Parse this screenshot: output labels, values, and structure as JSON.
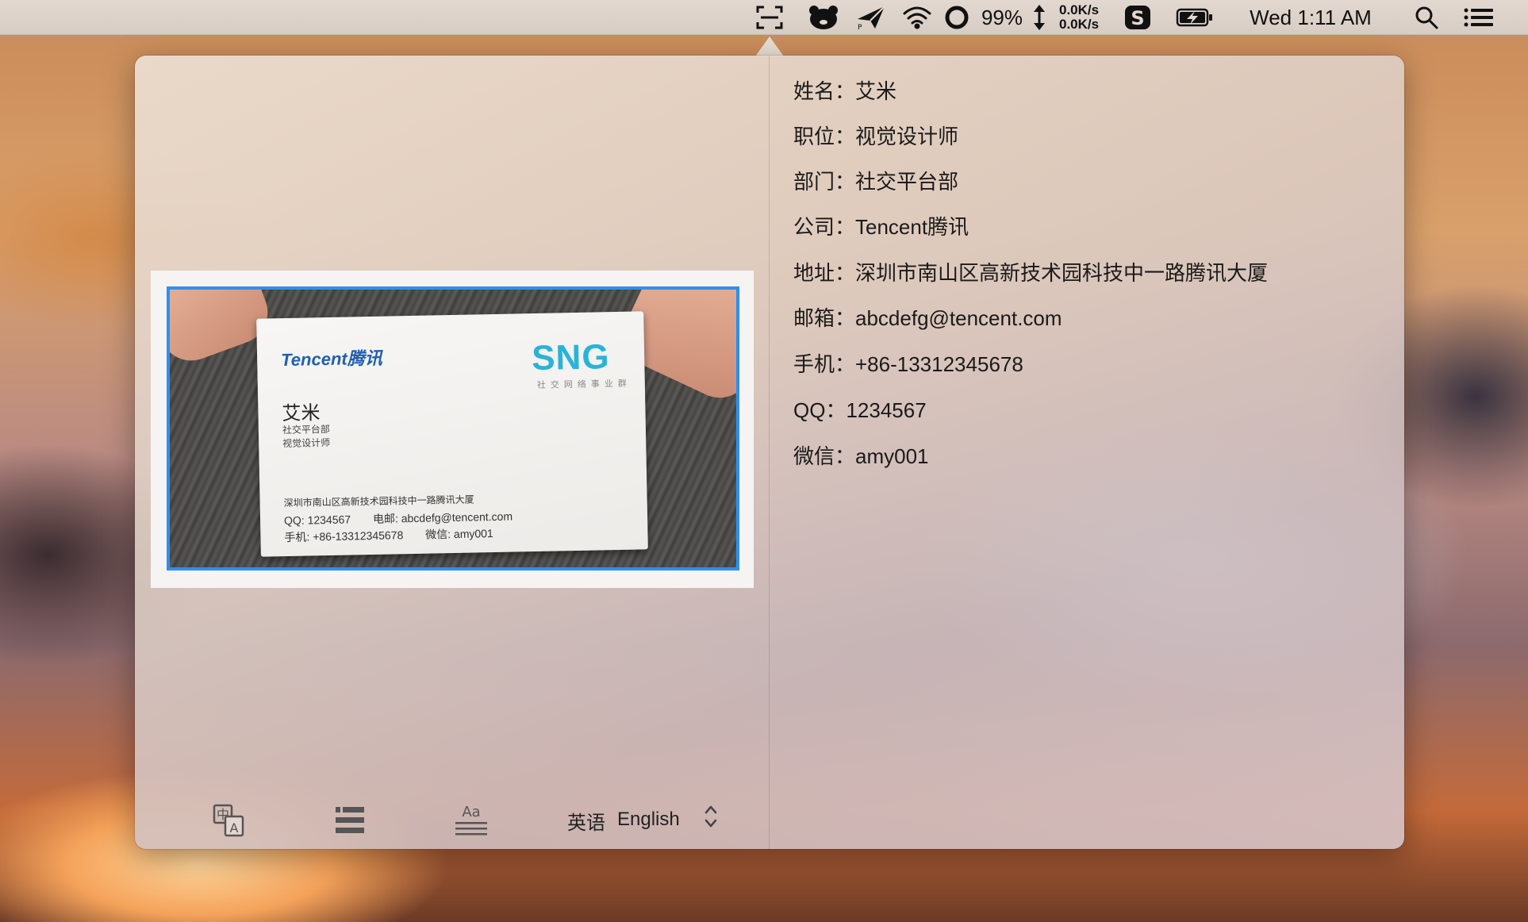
{
  "menubar": {
    "icons": [
      "screenshot-ocr-icon",
      "bear-icon",
      "paper-plane-icon",
      "wifi-icon",
      "istat-ring-icon",
      "updown-arrow-icon",
      "sogou-s-icon",
      "battery-charging-icon",
      "spotlight-search-icon",
      "notification-list-icon"
    ],
    "battery_percent": "99%",
    "net_up": "0.0K/s",
    "net_down": "0.0K/s",
    "clock": "Wed 1:11 AM"
  },
  "card_image": {
    "brand": "Tencent腾讯",
    "logo": "SNG",
    "logo_sub": "社交网络事业群",
    "name": "艾米",
    "department": "社交平台部",
    "title": "视觉设计师",
    "address": "深圳市南山区高新技术园科技中一路腾讯大厦",
    "qq": "QQ: 1234567",
    "email": "电邮: abcdefg@tencent.com",
    "phone": "手机: +86-13312345678",
    "wechat": "微信: amy001"
  },
  "toolbar": {
    "icons": [
      "translate-icon",
      "list-icon",
      "text-format-icon"
    ],
    "language_cn": "英语",
    "language_en": "English"
  },
  "results": [
    "姓名：艾米",
    "职位：视觉设计师",
    "部门：社交平台部",
    "公司：Tencent腾讯",
    "地址：深圳市南山区高新技术园科技中一路腾讯大厦",
    "邮箱：abcdefg@tencent.com",
    "手机：+86-13312345678",
    "QQ：1234567",
    "微信：amy001"
  ],
  "colors": {
    "selection_border": "#2d8ff2",
    "card_brand": "#1f5fb5",
    "card_logo": "#29b3d9"
  }
}
